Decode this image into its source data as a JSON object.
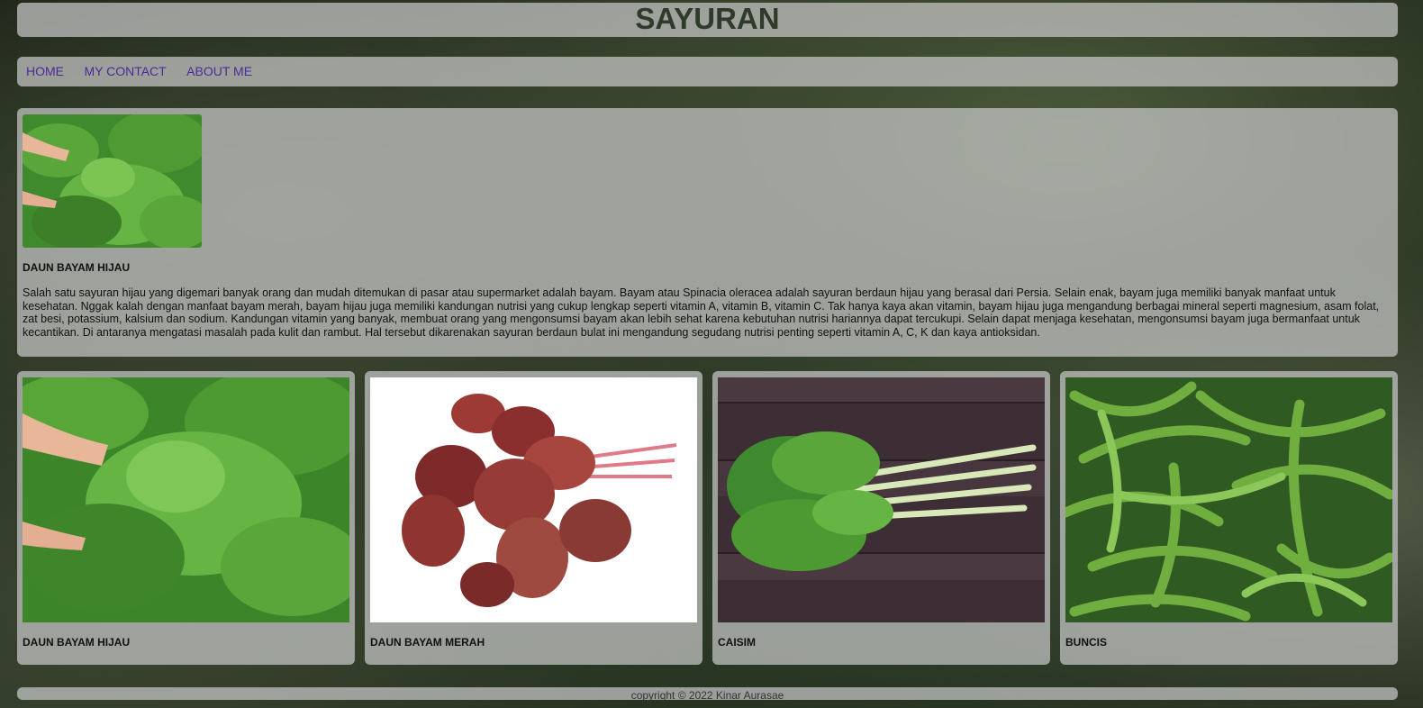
{
  "header": {
    "title": "SAYURAN"
  },
  "nav": {
    "items": [
      "HOME",
      "MY CONTACT",
      "ABOUT ME"
    ]
  },
  "featured": {
    "title": "DAUN BAYAM HIJAU",
    "description": "Salah satu sayuran hijau yang digemari banyak orang dan mudah ditemukan di pasar atau supermarket adalah bayam. Bayam atau Spinacia oleracea adalah sayuran berdaun hijau yang berasal dari Persia. Selain enak, bayam juga memiliki banyak manfaat untuk kesehatan. Nggak kalah dengan manfaat bayam merah, bayam hijau juga memiliki kandungan nutrisi yang cukup lengkap seperti vitamin A, vitamin B, vitamin C. Tak hanya kaya akan vitamin, bayam hijau juga mengandung berbagai mineral seperti magnesium, asam folat, zat besi, potassium, kalsium dan sodium. Kandungan vitamin yang banyak, membuat orang yang mengonsumsi bayam akan lebih sehat karena kebutuhan nutrisi hariannya dapat tercukupi. Selain dapat menjaga kesehatan, mengonsumsi bayam juga bermanfaat untuk kecantikan. Di antaranya mengatasi masalah pada kulit dan rambut. Hal tersebut dikarenakan sayuran berdaun bulat ini mengandung segudang nutrisi penting seperti vitamin A, C, K dan kaya antioksidan."
  },
  "cards": [
    {
      "title": "DAUN BAYAM HIJAU"
    },
    {
      "title": "DAUN BAYAM MERAH"
    },
    {
      "title": "CAISIM"
    },
    {
      "title": "BUNCIS"
    }
  ],
  "footer": {
    "text": "copyright © 2022 Kinar Aurasae"
  },
  "colors": {
    "title": "#2f3b2a",
    "nav_link": "#4b2a9a",
    "panel": "rgba(200,200,200,0.72)"
  }
}
